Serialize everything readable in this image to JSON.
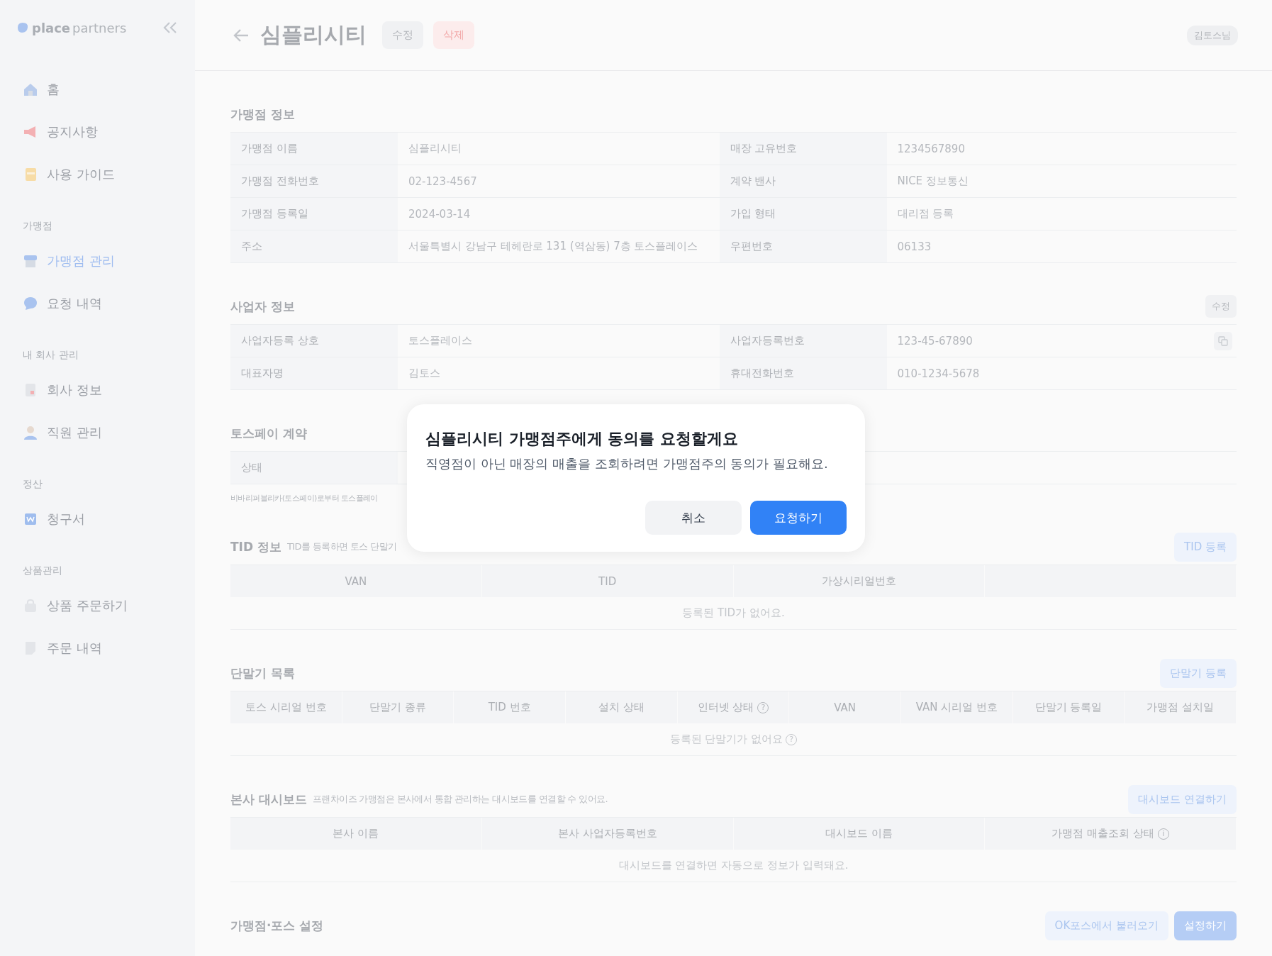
{
  "sidebar": {
    "logo": {
      "bold": "place",
      "light": "partners"
    },
    "groups": [
      {
        "items": [
          {
            "kind": "home",
            "label": "홈",
            "selected": false
          },
          {
            "kind": "megaphone",
            "label": "공지사항",
            "selected": false
          },
          {
            "kind": "book",
            "label": "사용 가이드",
            "selected": false
          }
        ]
      },
      {
        "label": "가맹점",
        "items": [
          {
            "kind": "store",
            "label": "가맹점 관리",
            "selected": true
          },
          {
            "kind": "chat",
            "label": "요청 내역",
            "selected": false
          }
        ]
      },
      {
        "label": "내 회사 관리",
        "items": [
          {
            "kind": "document",
            "label": "회사 정보",
            "selected": false
          },
          {
            "kind": "person",
            "label": "직원 관리",
            "selected": false
          }
        ]
      },
      {
        "label": "정산",
        "items": [
          {
            "kind": "invoice",
            "label": "청구서",
            "selected": false
          }
        ]
      },
      {
        "label": "상품관리",
        "items": [
          {
            "kind": "bag",
            "label": "상품 주문하기",
            "selected": false
          },
          {
            "kind": "note",
            "label": "주문 내역",
            "selected": false
          }
        ]
      }
    ]
  },
  "header": {
    "title": "심플리시티",
    "edit_button": "수정",
    "delete_button": "삭제",
    "user": "김토스님"
  },
  "sections": [
    {
      "kind": "info",
      "title": "가맹점 정보",
      "rows": [
        {
          "cells": [
            "가맹점 이름",
            "심플리시티",
            "매장 고유번호",
            "1234567890"
          ]
        },
        {
          "cells": [
            "가맹점 전화번호",
            "02-123-4567",
            "계약 밴사",
            "NICE 정보통신"
          ]
        },
        {
          "cells": [
            "가맹점 등록일",
            "2024-03-14",
            "가입 형태",
            "대리점 등록"
          ]
        },
        {
          "cells": [
            "주소",
            "서울특별시 강남구 테헤란로 131 (역삼동) 7층 토스플레이스",
            "우편번호",
            "06133"
          ]
        }
      ]
    },
    {
      "kind": "info",
      "title": "사업자 정보",
      "action": "수정",
      "rows": [
        {
          "cells": [
            "사업자등록 상호",
            "토스플레이스",
            "사업자등록번호",
            "123-45-67890"
          ],
          "copy": true
        },
        {
          "cells": [
            "대표자명",
            "김토스",
            "휴대전화번호",
            "010-1234-5678"
          ],
          "copy": false
        }
      ]
    },
    {
      "kind": "info",
      "title": "토스페이 계약",
      "rows": [
        {
          "cells": [
            "상태"
          ]
        }
      ],
      "note": "비바리퍼블리카(토스페이)로부터 토스플레이"
    },
    {
      "kind": "table",
      "title": "TID 정보",
      "subtitle": "TID를 등록하면 토스 단말기",
      "action": "TID 등록",
      "columns": [
        {
          "label": "VAN"
        },
        {
          "label": "TID"
        },
        {
          "label": "가상시리얼번호"
        },
        {}
      ],
      "empty": "등록된 TID가 없어요."
    },
    {
      "kind": "table",
      "title": "단말기 목록",
      "action": "단말기 등록",
      "columns": [
        {
          "label": "토스 시리얼 번호"
        },
        {
          "label": "단말기 종류"
        },
        {
          "label": "TID 번호"
        },
        {
          "label": "설치 상태"
        },
        {
          "label": "인터넷 상태",
          "help": "?"
        },
        {
          "label": "VAN"
        },
        {
          "label": "VAN 시리얼 번호"
        },
        {
          "label": "단말기 등록일"
        },
        {
          "label": "가맹점 설치일"
        }
      ],
      "empty": "등록된 단말기가 없어요",
      "empty_help": "?"
    },
    {
      "kind": "table",
      "title": "본사 대시보드",
      "subtitle": "프랜차이즈 가맹점은 본사에서 통합 관리하는 대시보드를 연결할 수 있어요.",
      "action": "대시보드 연결하기",
      "columns": [
        {
          "label": "본사 이름"
        },
        {
          "label": "본사 사업자등록번호"
        },
        {
          "label": "대시보드 이름"
        },
        {
          "label": "가맹점 매출조회 상태",
          "help": "i"
        }
      ],
      "empty": "대시보드를 연결하면 자동으로 정보가 입력돼요."
    },
    {
      "kind": "footer",
      "title": "가맹점·포스 설정",
      "secondary": "OK포스에서 불러오기",
      "action": "설정하기"
    }
  ],
  "dialog": {
    "title": "심플리시티 가맹점주에게 동의를 요청할게요",
    "message": "직영점이 아닌 매장의 매출을 조회하려면 가맹점주의 동의가 필요해요.",
    "cancel": "취소",
    "confirm": "요청하기"
  }
}
